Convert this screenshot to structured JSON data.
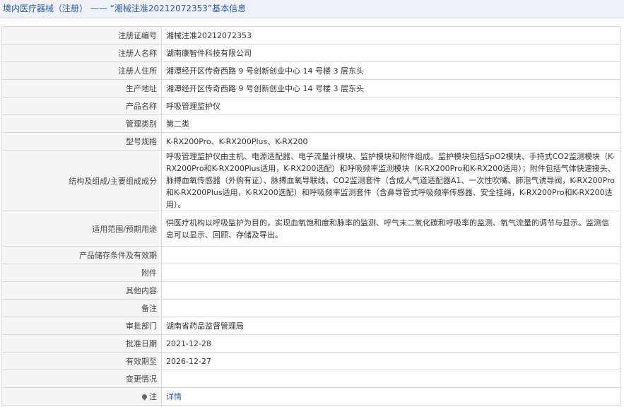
{
  "header": {
    "breadcrumb_root": "境内医疗器械（注册）",
    "separator": "——",
    "title": "“湘械注准20212072353”基本信息"
  },
  "rows": [
    {
      "label": "注册证编号",
      "value": "湘械注准20212072353"
    },
    {
      "label": "注册人名称",
      "value": "湖南康智件科技有限公司"
    },
    {
      "label": "注册人住所",
      "value": "湘潭经开区传奇西路 9 号创新创业中心 14 号楼 3 层东头"
    },
    {
      "label": "生产地址",
      "value": "湘潭经开区传奇西路 9 号创新创业中心 14 号楼 3 层东头"
    },
    {
      "label": "产品名称",
      "value": "呼吸管理监护仪"
    },
    {
      "label": "管理类别",
      "value": "第二类"
    },
    {
      "label": "型号规格",
      "value": "K-RX200Pro、K-RX200Plus、K-RX200"
    },
    {
      "label": "结构及组成/主要组成成分",
      "value": "呼吸管理监护仪由主机、电源适配器、电子流量计模块、监护模块和附件组成。监护模块包括SpO2模块、手持式CO2监测模块（K-RX200Pro和K-RX200Plus适用，K-RX200选配）和呼吸频率监测模块（K-RX200Pro和K-RX200适用）；附件包括气体快速接头、脉搏血氧传感器（外购有证）、脉搏血氧导联线、CO2监测套件（含成人气道适配器A1、一次性吹嘴、肺泡气诱导阀，K-RX200Pro和K-RX200Plus适用，K-RX200选配）和呼吸频率监测套件（含鼻导管式呼吸频率传感器、安全挂绳，K-RX200Pro和K-RX200适用）。"
    },
    {
      "label": "适用范围/预期用途",
      "value": "供医疗机构以呼吸监护为目的，实现血氧饱和度和脉率的监测、呼气末二氧化碳和呼吸率的监测、氧气流量的调节与显示。监测信息可以显示、回顾、存储及导出。"
    },
    {
      "label": "产品储存条件及有效期",
      "value": ""
    },
    {
      "label": "附件",
      "value": ""
    },
    {
      "label": "其他内容",
      "value": ""
    },
    {
      "label": "备注",
      "value": ""
    },
    {
      "label": "审批部门",
      "value": "湖南省药品监督管理局"
    },
    {
      "label": "批准日期",
      "value": "2021-12-28"
    },
    {
      "label": "有效期至",
      "value": "2026-12-27"
    },
    {
      "label": "变更情况",
      "value": ""
    }
  ],
  "note_row": {
    "label": "注",
    "icon": "location-pin-icon",
    "link_text": "详情"
  }
}
